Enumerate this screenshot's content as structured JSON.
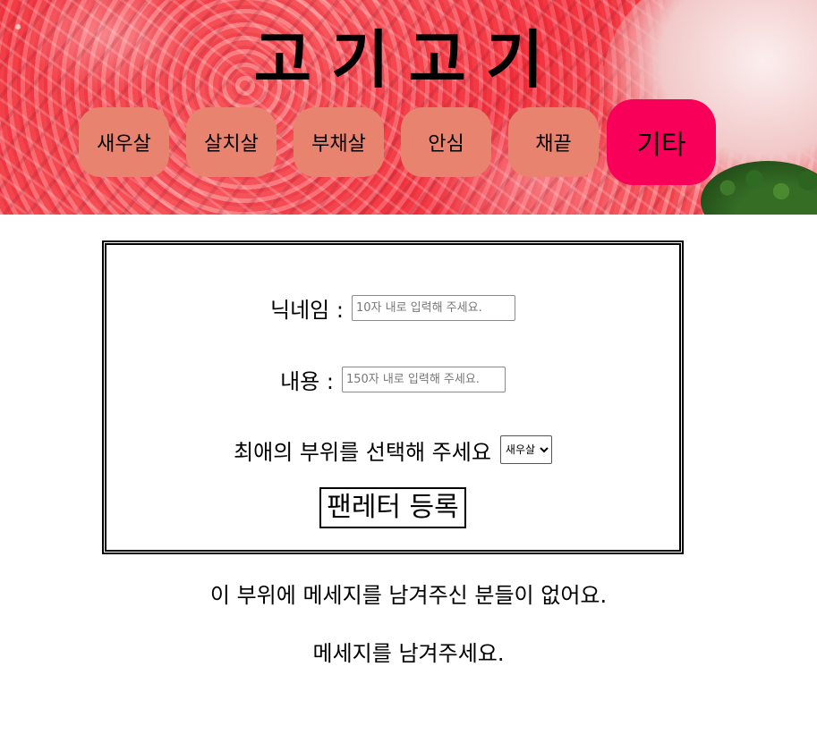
{
  "site": {
    "title": "고기고기"
  },
  "nav": {
    "items": [
      {
        "label": "새우살"
      },
      {
        "label": "살치살"
      },
      {
        "label": "부채살"
      },
      {
        "label": "안심"
      },
      {
        "label": "채끝"
      },
      {
        "label": "기타"
      }
    ],
    "active_index": 5,
    "colors": {
      "default": "#e8836f",
      "active": "#f8005a"
    }
  },
  "form": {
    "nickname_label": "닉네임 :",
    "nickname_placeholder": "10자 내로 입력해 주세요.",
    "nickname_value": "",
    "content_label": "내용 :",
    "content_placeholder": "150자 내로 입력해 주세요.",
    "content_value": "",
    "favorite_label": "최애의 부위를 선택해 주세요",
    "favorite_selected": "새우살",
    "submit_label": "팬레터 등록"
  },
  "messages": {
    "empty_notice": "이 부위에 메세지를 남겨주신 분들이 없어요.",
    "prompt": "메세지를 남겨주세요."
  }
}
